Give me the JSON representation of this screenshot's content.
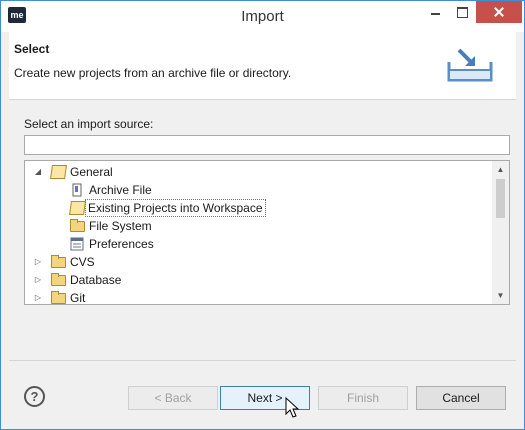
{
  "window": {
    "title": "Import",
    "app_icon": "me"
  },
  "banner": {
    "title": "Select",
    "description": "Create new projects from an archive file or directory.",
    "icon": "import-tray-icon"
  },
  "source": {
    "label": "Select an import source:",
    "filter_value": ""
  },
  "tree": [
    {
      "label": "General",
      "expanded": true,
      "icon": "open-folder-icon"
    },
    {
      "label": "Archive File",
      "icon": "archive-file-icon"
    },
    {
      "label": "Existing Projects into Workspace",
      "icon": "project-folder-icon",
      "selected": true
    },
    {
      "label": "File System",
      "icon": "folder-icon"
    },
    {
      "label": "Preferences",
      "icon": "preferences-icon"
    },
    {
      "label": "CVS",
      "expanded": false,
      "icon": "folder-icon"
    },
    {
      "label": "Database",
      "expanded": false,
      "icon": "folder-icon"
    },
    {
      "label": "Git",
      "expanded": false,
      "icon": "folder-icon"
    }
  ],
  "buttons": {
    "help": "?",
    "back": "< Back",
    "next": "Next >",
    "finish": "Finish",
    "cancel": "Cancel"
  },
  "colors": {
    "title_border": "#3f8dd6",
    "close": "#c7504b",
    "focus_border": "#3c7fb1"
  }
}
